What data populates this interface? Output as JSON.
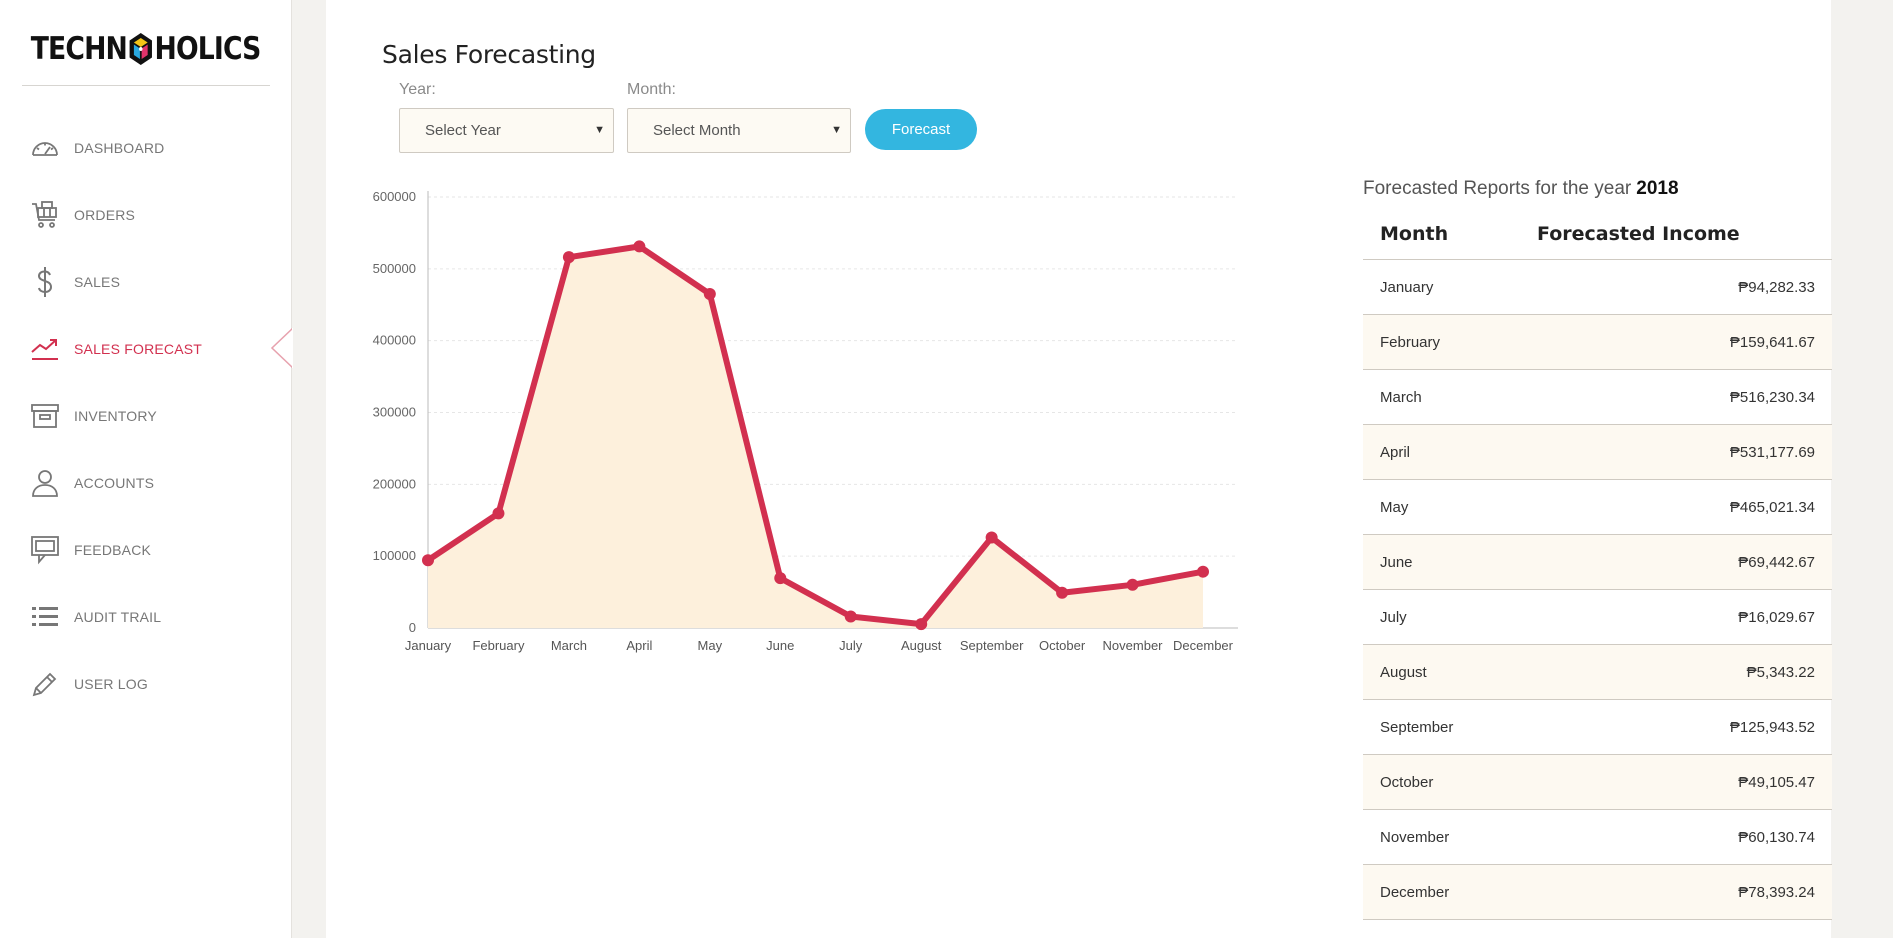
{
  "brand": {
    "logo_left": "TECHN",
    "logo_right": "HOLICS"
  },
  "sidebar": {
    "items": [
      {
        "label": "DASHBOARD",
        "icon": "speedometer-icon",
        "active": false
      },
      {
        "label": "ORDERS",
        "icon": "cart-icon",
        "active": false
      },
      {
        "label": "SALES",
        "icon": "dollar-icon",
        "active": false
      },
      {
        "label": "SALES FORECAST",
        "icon": "trend-up-icon",
        "active": true
      },
      {
        "label": "INVENTORY",
        "icon": "archive-box-icon",
        "active": false
      },
      {
        "label": "ACCOUNTS",
        "icon": "user-icon",
        "active": false
      },
      {
        "label": "FEEDBACK",
        "icon": "chat-bubble-icon",
        "active": false
      },
      {
        "label": "AUDIT TRAIL",
        "icon": "list-icon",
        "active": false
      },
      {
        "label": "USER LOG",
        "icon": "pencil-icon",
        "active": false
      }
    ]
  },
  "page": {
    "title": "Sales Forecasting"
  },
  "filters": {
    "year_label": "Year:",
    "year_value": "Select Year",
    "month_label": "Month:",
    "month_value": "Select Month",
    "forecast_button": "Forecast"
  },
  "colors": {
    "accent": "#d2304f",
    "button": "#33b6e0",
    "area_fill": "#fdf0dc"
  },
  "chart_data": {
    "type": "area",
    "categories": [
      "January",
      "February",
      "March",
      "April",
      "May",
      "June",
      "July",
      "August",
      "September",
      "October",
      "November",
      "December"
    ],
    "values": [
      94282.33,
      159641.67,
      516230.34,
      531177.69,
      465021.34,
      69442.67,
      16029.67,
      5343.22,
      125943.52,
      49105.47,
      60130.74,
      78393.24
    ],
    "yticks": [
      0,
      100000,
      200000,
      300000,
      400000,
      500000,
      600000
    ],
    "ylim": [
      0,
      600000
    ],
    "grid": true,
    "title": "",
    "xlabel": "",
    "ylabel": ""
  },
  "report": {
    "title_prefix": "Forecasted Reports for the year",
    "year": "2018",
    "col_month": "Month",
    "col_income": "Forecasted Income",
    "rows": [
      {
        "month": "January",
        "income": "₱94,282.33"
      },
      {
        "month": "February",
        "income": "₱159,641.67"
      },
      {
        "month": "March",
        "income": "₱516,230.34"
      },
      {
        "month": "April",
        "income": "₱531,177.69"
      },
      {
        "month": "May",
        "income": "₱465,021.34"
      },
      {
        "month": "June",
        "income": "₱69,442.67"
      },
      {
        "month": "July",
        "income": "₱16,029.67"
      },
      {
        "month": "August",
        "income": "₱5,343.22"
      },
      {
        "month": "September",
        "income": "₱125,943.52"
      },
      {
        "month": "October",
        "income": "₱49,105.47"
      },
      {
        "month": "November",
        "income": "₱60,130.74"
      },
      {
        "month": "December",
        "income": "₱78,393.24"
      }
    ]
  }
}
